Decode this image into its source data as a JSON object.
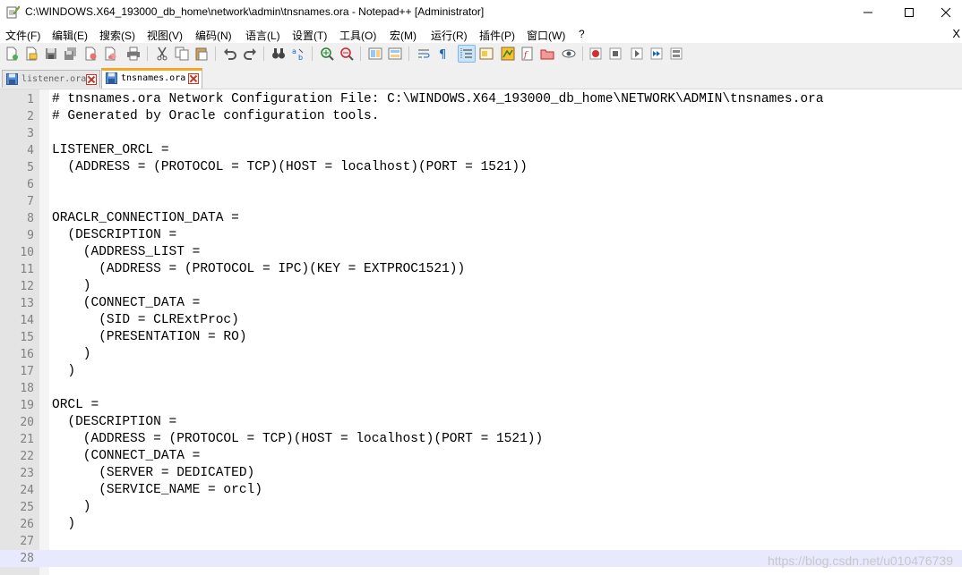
{
  "window": {
    "title": "C:\\WINDOWS.X64_193000_db_home\\network\\admin\\tnsnames.ora - Notepad++ [Administrator]",
    "minimize_label": "minimize",
    "maximize_label": "maximize",
    "close_label": "close"
  },
  "menu": {
    "items": [
      "文件(F)",
      "编辑(E)",
      "搜索(S)",
      "视图(V)",
      "编码(N)",
      "语言(L)",
      "设置(T)",
      "工具(O)",
      "宏(M)",
      "运行(R)",
      "插件(P)",
      "窗口(W)",
      "?"
    ],
    "close_doc": "X"
  },
  "tabs": [
    {
      "label": "listener.ora",
      "active": false
    },
    {
      "label": "tnsnames.ora",
      "active": true
    }
  ],
  "editor": {
    "lines": [
      "# tnsnames.ora Network Configuration File: C:\\WINDOWS.X64_193000_db_home\\NETWORK\\ADMIN\\tnsnames.ora",
      "# Generated by Oracle configuration tools.",
      "",
      "LISTENER_ORCL =",
      "  (ADDRESS = (PROTOCOL = TCP)(HOST = localhost)(PORT = 1521))",
      "",
      "",
      "ORACLR_CONNECTION_DATA =",
      "  (DESCRIPTION =",
      "    (ADDRESS_LIST =",
      "      (ADDRESS = (PROTOCOL = IPC)(KEY = EXTPROC1521))",
      "    )",
      "    (CONNECT_DATA =",
      "      (SID = CLRExtProc)",
      "      (PRESENTATION = RO)",
      "    )",
      "  )",
      "",
      "ORCL =",
      "  (DESCRIPTION =",
      "    (ADDRESS = (PROTOCOL = TCP)(HOST = localhost)(PORT = 1521))",
      "    (CONNECT_DATA =",
      "      (SERVER = DEDICATED)",
      "      (SERVICE_NAME = orcl)",
      "    )",
      "  )",
      "",
      ""
    ],
    "current_line": 28
  },
  "watermark": "https://blog.csdn.net/u010476739",
  "colors": {
    "gutter": "#e4e4e4",
    "current_line": "#e8e8ff",
    "active_tab_accent": "#f5a623",
    "toolbar": "#f0f0f0"
  }
}
